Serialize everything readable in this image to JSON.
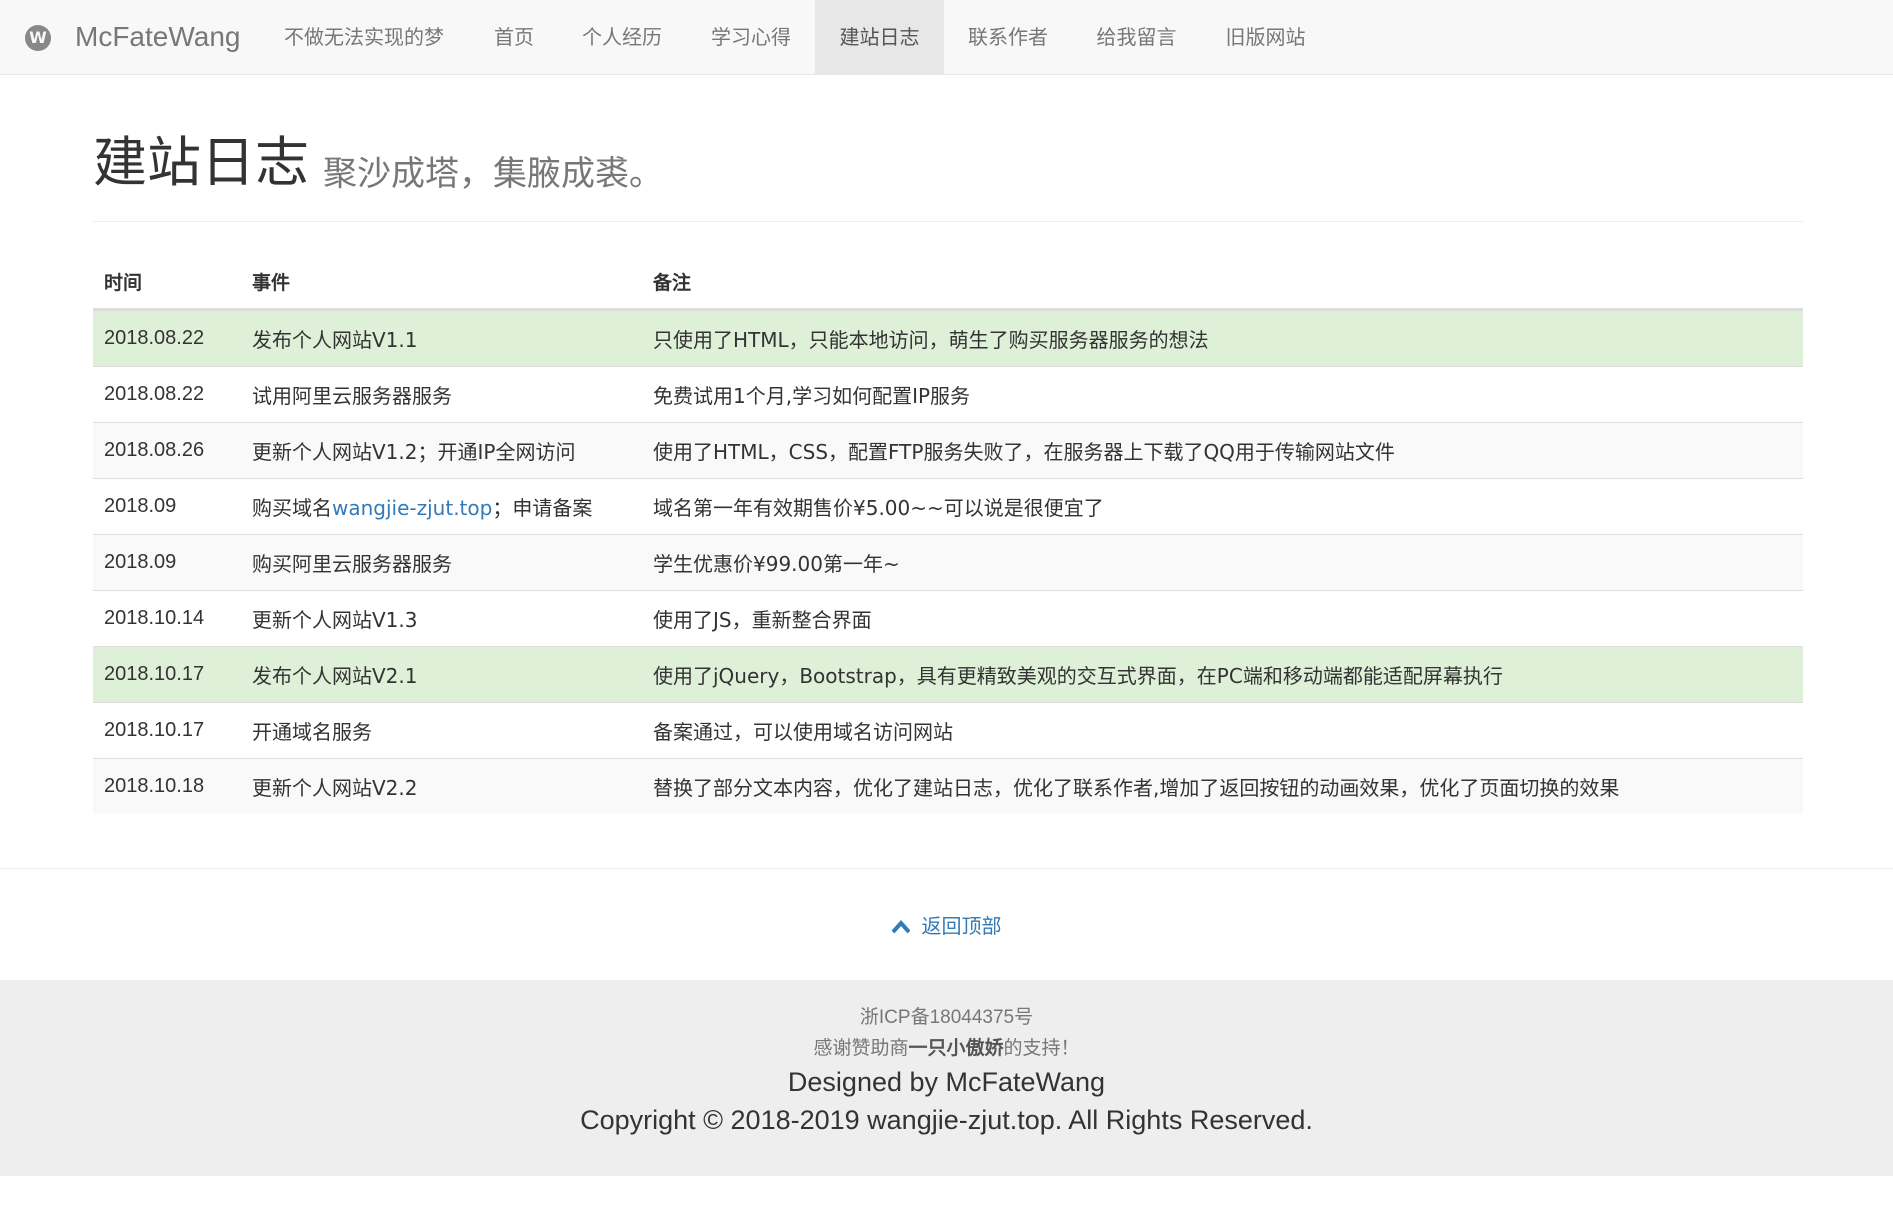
{
  "navbar": {
    "logo_letter": "W",
    "brand": "McFateWang",
    "items": [
      {
        "label": "不做无法实现的梦"
      },
      {
        "label": "首页"
      },
      {
        "label": "个人经历"
      },
      {
        "label": "学习心得"
      },
      {
        "label": "建站日志",
        "active": true
      },
      {
        "label": "联系作者"
      },
      {
        "label": "给我留言"
      },
      {
        "label": "旧版网站"
      }
    ]
  },
  "header": {
    "title": "建站日志",
    "subtitle": "聚沙成塔，集腋成裘。"
  },
  "table": {
    "columns": [
      "时间",
      "事件",
      "备注"
    ],
    "rows": [
      {
        "date": "2018.08.22",
        "event": "发布个人网站V1.1",
        "note": "只使用了HTML，只能本地访问，萌生了购买服务器服务的想法",
        "highlight": "success"
      },
      {
        "date": "2018.08.22",
        "event": "试用阿里云服务器服务",
        "note": "免费试用1个月,学习如何配置IP服务",
        "highlight": "none"
      },
      {
        "date": "2018.08.26",
        "event": "更新个人网站V1.2；开通IP全网访问",
        "note": "使用了HTML，CSS，配置FTP服务失败了，在服务器上下载了QQ用于传输网站文件",
        "highlight": "striped"
      },
      {
        "date": "2018.09",
        "event_before": "购买域名",
        "event_link": "wangjie-zjut.top",
        "event_after": "；申请备案",
        "note": "域名第一年有效期售价¥5.00~~可以说是很便宜了",
        "highlight": "none"
      },
      {
        "date": "2018.09",
        "event": "购买阿里云服务器服务",
        "note": "学生优惠价¥99.00第一年~",
        "highlight": "striped"
      },
      {
        "date": "2018.10.14",
        "event": "更新个人网站V1.3",
        "note": "使用了JS，重新整合界面",
        "highlight": "none"
      },
      {
        "date": "2018.10.17",
        "event": "发布个人网站V2.1",
        "note": "使用了jQuery，Bootstrap，具有更精致美观的交互式界面，在PC端和移动端都能适配屏幕执行",
        "highlight": "success"
      },
      {
        "date": "2018.10.17",
        "event": "开通域名服务",
        "note": "备案通过，可以使用域名访问网站",
        "highlight": "none"
      },
      {
        "date": "2018.10.18",
        "event": "更新个人网站V2.2",
        "note": "替换了部分文本内容，优化了建站日志，优化了联系作者,增加了返回按钮的动画效果，优化了页面切换的效果",
        "highlight": "striped"
      }
    ]
  },
  "back_to_top": {
    "icon": "chevron-up-icon",
    "label": "返回顶部"
  },
  "footer": {
    "icp": "浙ICP备18044375号",
    "thanks_before": "感谢赞助商",
    "thanks_sponsor": "一只小傲娇",
    "thanks_after": "的支持！",
    "designed": "Designed by McFateWang",
    "copyright": "Copyright © 2018-2019 wangjie-zjut.top. All Rights Reserved."
  },
  "colors": {
    "navbar_bg": "#f8f8f8",
    "active_tab_bg": "#e7e7e7",
    "success_row": "#dff0d8",
    "striped_row": "#f9f9f9",
    "link": "#337ab7",
    "footer_bg": "#eeeeee"
  }
}
